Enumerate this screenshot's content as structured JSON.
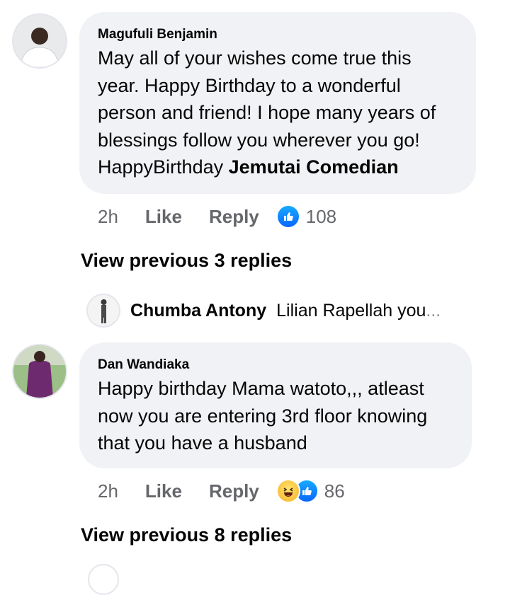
{
  "comments": [
    {
      "author": "Magufuli Benjamin",
      "text": "May all of your wishes come true this year. Happy Birthday to a wonderful person and friend! I hope many years of blessings follow you wherever you go! HappyBirthday ",
      "mention": "Jemutai Comedian",
      "time": "2h",
      "like_label": "Like",
      "reply_label": "Reply",
      "reactions": [
        "like-icon"
      ],
      "reaction_count": "108"
    },
    {
      "author": "Dan Wandiaka",
      "text": "Happy birthday Mama watoto,,, atleast now you are entering 3rd floor knowing that you have a husband",
      "time": "2h",
      "like_label": "Like",
      "reply_label": "Reply",
      "reactions": [
        "haha-icon",
        "like-icon"
      ],
      "reaction_count": "86"
    }
  ],
  "view_previous_1": "View previous 3 replies",
  "reply_preview": {
    "name": "Chumba Antony",
    "snippet": "Lilian Rapellah you",
    "ellipsis": "..."
  },
  "view_previous_2": "View previous 8 replies",
  "colors": {
    "bubble_bg": "#f0f2f5",
    "secondary_text": "#65676b",
    "like_blue": "#0866ff"
  }
}
